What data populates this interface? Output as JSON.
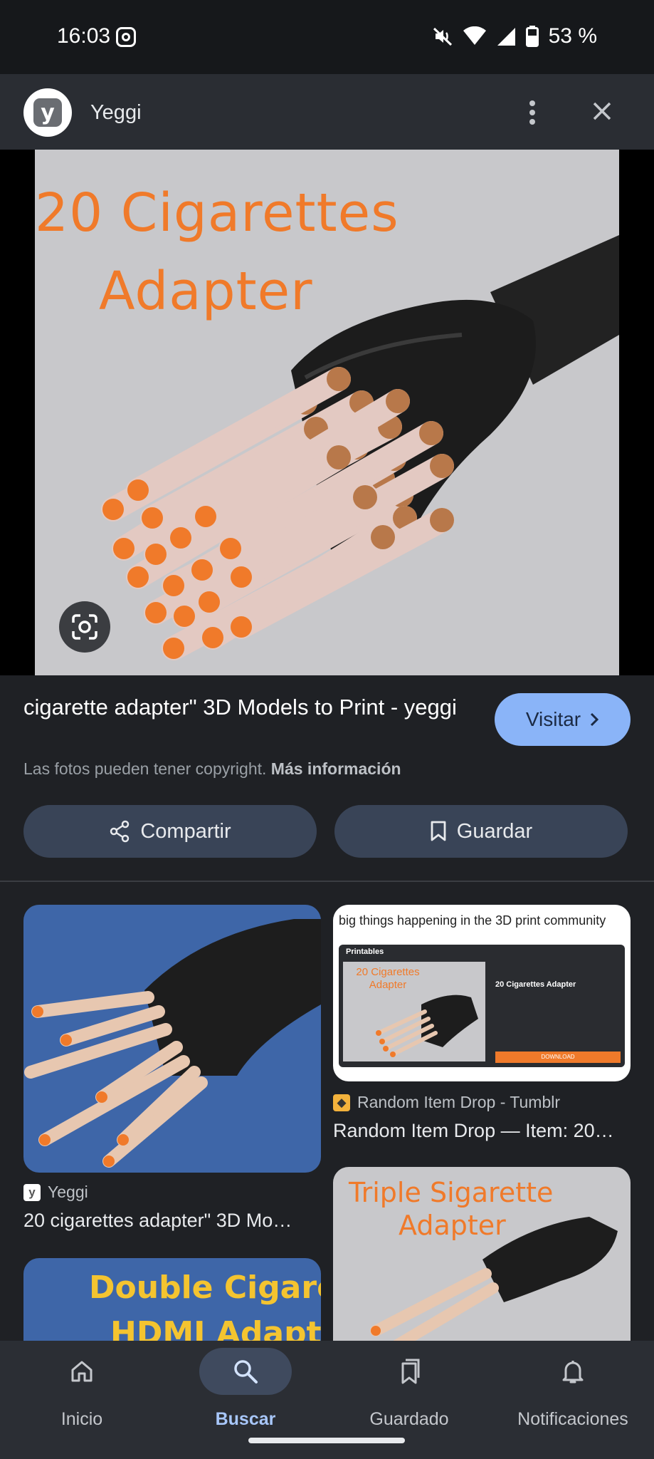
{
  "status_bar": {
    "time": "16:03",
    "battery": "53 %"
  },
  "header": {
    "title": "Yeggi",
    "logo_letter": "y"
  },
  "main_image": {
    "line1": "20 Cigarettes",
    "line2": "Adapter"
  },
  "result": {
    "title": "cigarette adapter\" 3D Models to Print - yeggi",
    "visit_label": "Visitar",
    "copyright_text": "Las fotos pueden tener copyright.",
    "more_info": "Más información",
    "share_label": "Compartir",
    "save_label": "Guardar"
  },
  "related": [
    {
      "source": "Yeggi",
      "title": "20 cigarettes adapter\" 3D Mo…"
    },
    {
      "source": "Random Item Drop - Tumblr",
      "title": "Random Item Drop — Item: 20…",
      "thumb_caption": "big things happening in the 3D print community",
      "mock_brand": "Printables",
      "mock_img_text": "20 Cigarettes Adapter",
      "mock_title": "20 Cigarettes Adapter",
      "mock_button": "DOWNLOAD"
    },
    {
      "img_line1": "Double Cigarett",
      "img_line2": "HDMI Adapter"
    },
    {
      "img_line1": "Triple Sigarette",
      "img_line2": "Adapter"
    }
  ],
  "nav": [
    {
      "label": "Inicio",
      "icon": "home-icon"
    },
    {
      "label": "Buscar",
      "icon": "search-icon",
      "active": true
    },
    {
      "label": "Guardado",
      "icon": "bookmarks-icon"
    },
    {
      "label": "Notificaciones",
      "icon": "bell-icon"
    }
  ],
  "colors": {
    "accent": "#8ab4f8",
    "orange": "#f07a2a",
    "background": "#1f2125"
  }
}
